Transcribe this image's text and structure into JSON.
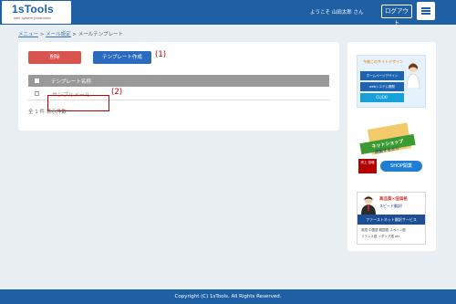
{
  "header": {
    "logo_text": "1sTools",
    "logo_sub": "web system production",
    "welcome": "ようこそ 山田太郎 さん",
    "logout_label": "ログアウト",
    "menu_icon": "hamburger-menu-icon",
    "bg_color": "#1f5fa4"
  },
  "breadcrumb": {
    "items": [
      "メニュー",
      "メール設定",
      "メールテンプレート"
    ],
    "separator": ">"
  },
  "toolbar": {
    "delete_label": "削除",
    "create_label": "テンプレート作成",
    "create_annotation": "(1)"
  },
  "table": {
    "header": "テンプレート名称",
    "rows": [
      {
        "name": "サンプルメール",
        "annotation": "(2)"
      }
    ],
    "count_text": "全 1 件 表示件数"
  },
  "sidebar": {
    "banner1": {
      "title": "今後このサイトデザイン",
      "line1": "ホームページデザイン",
      "line2": "webシステム開発",
      "line3": "CLICK!"
    },
    "banner2": {
      "title": "ネットショップ",
      "subtitle": "開業するなら",
      "badge": "売上 倍増",
      "pill": "SHOP開業"
    },
    "banner3": {
      "title": "高品質×低価格",
      "subtitle": "スピード翻訳!",
      "bar": "ファーストネット翻訳サービス",
      "line1": "英語 中国語 韓国語 スペイン語",
      "line2": "フランス語 イタリア語 etc"
    }
  },
  "footer": {
    "copyright": "Copyright (C) 1sTools. All Rights Reserved."
  },
  "colors": {
    "primary": "#1f5fa4",
    "danger": "#d9534f",
    "button_blue": "#2a6bbf",
    "annotation_red": "#c00000"
  }
}
